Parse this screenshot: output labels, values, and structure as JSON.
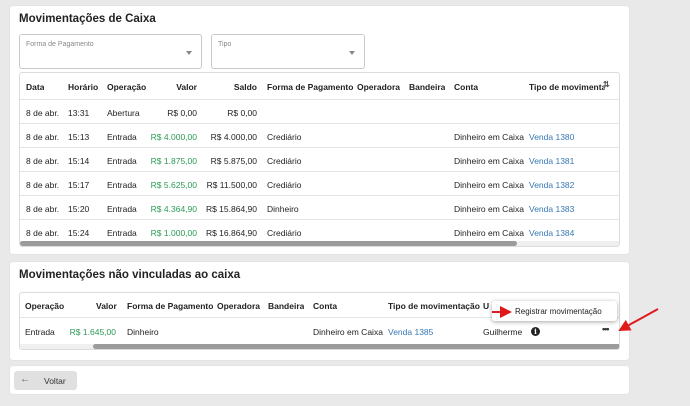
{
  "card1": {
    "title": "Movimentações de Caixa",
    "filter_payment": {
      "placeholder": "Forma de Pagamento"
    },
    "filter_type": {
      "placeholder": "Tipo"
    },
    "headers": [
      "Data",
      "Horário",
      "Operação",
      "Valor",
      "Saldo",
      "Forma de Pagamento",
      "Operadora",
      "Bandeira",
      "Conta",
      "Tipo de movimentaçã"
    ],
    "rows": [
      {
        "data": "8 de abr.",
        "hora": "13:31",
        "op": "Abertura",
        "valor": "R$ 0,00",
        "saldo": "R$ 0,00",
        "forma": "",
        "operadora": "",
        "bandeira": "",
        "conta": "",
        "tipo": ""
      },
      {
        "data": "8 de abr.",
        "hora": "15:13",
        "op": "Entrada",
        "valor": "R$ 4.000,00",
        "saldo": "R$ 4.000,00",
        "forma": "Crediário",
        "operadora": "",
        "bandeira": "",
        "conta": "Dinheiro em Caixa",
        "tipo": "Venda 1380"
      },
      {
        "data": "8 de abr.",
        "hora": "15:14",
        "op": "Entrada",
        "valor": "R$ 1.875,00",
        "saldo": "R$ 5.875,00",
        "forma": "Crediário",
        "operadora": "",
        "bandeira": "",
        "conta": "Dinheiro em Caixa",
        "tipo": "Venda 1381"
      },
      {
        "data": "8 de abr.",
        "hora": "15:17",
        "op": "Entrada",
        "valor": "R$ 5.625,00",
        "saldo": "R$ 11.500,00",
        "forma": "Crediário",
        "operadora": "",
        "bandeira": "",
        "conta": "Dinheiro em Caixa",
        "tipo": "Venda 1382"
      },
      {
        "data": "8 de abr.",
        "hora": "15:20",
        "op": "Entrada",
        "valor": "R$ 4.364,90",
        "saldo": "R$ 15.864,90",
        "forma": "Dinheiro",
        "operadora": "",
        "bandeira": "",
        "conta": "Dinheiro em Caixa",
        "tipo": "Venda 1383"
      },
      {
        "data": "8 de abr.",
        "hora": "15:24",
        "op": "Entrada",
        "valor": "R$ 1.000,00",
        "saldo": "R$ 16.864,90",
        "forma": "Crediário",
        "operadora": "",
        "bandeira": "",
        "conta": "Dinheiro em Caixa",
        "tipo": "Venda 1384"
      }
    ]
  },
  "card2": {
    "title": "Movimentações não vinculadas ao caixa",
    "headers": [
      "Operação",
      "Valor",
      "Forma de Pagamento",
      "Operadora",
      "Bandeira",
      "Conta",
      "Tipo de movimentação",
      "U"
    ],
    "row": {
      "op": "Entrada",
      "valor": "R$ 1.645,00",
      "forma": "Dinheiro",
      "operadora": "",
      "bandeira": "",
      "conta": "Dinheiro em Caixa",
      "tipo": "Venda 1385",
      "usuario": "Guilherme"
    },
    "menu_item": "Registrar movimentação"
  },
  "footer": {
    "back_label": "Voltar"
  },
  "colors": {
    "green": "#2a9a55",
    "link": "#3a78b5",
    "arrow": "#e0191b"
  }
}
